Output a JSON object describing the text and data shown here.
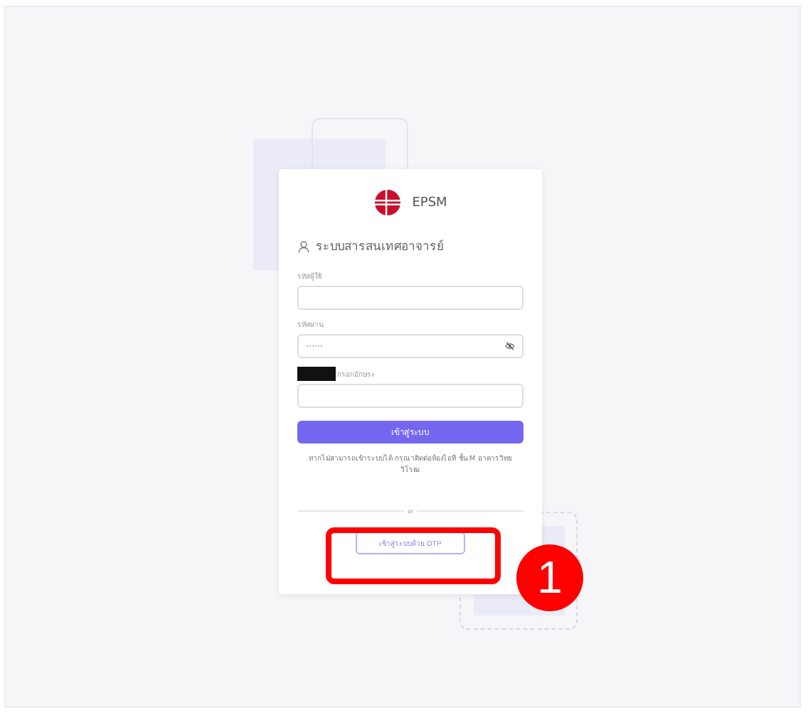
{
  "brand": {
    "name": "EPSM"
  },
  "title": "ระบบสารสนเทศอาจารย์",
  "fields": [
    {
      "kind": "text",
      "label": "รหัสผู้ใช้"
    },
    {
      "kind": "password",
      "label": "รหัสผ่าน",
      "placeholder": "······"
    },
    {
      "kind": "captcha",
      "label": "กรอกอักษระ"
    }
  ],
  "login_button": "เข้าสู่ระบบ",
  "help_text": "หากไม่สามารถเข้าระบบได้ กรุณาติดต่อห้องไอที ชั้น M อาคารวิทยวิโรฒ",
  "divider_text": "or",
  "otp_button": "เข้าสู่ระบบด้วย OTP",
  "annotation": {
    "number": "1"
  }
}
